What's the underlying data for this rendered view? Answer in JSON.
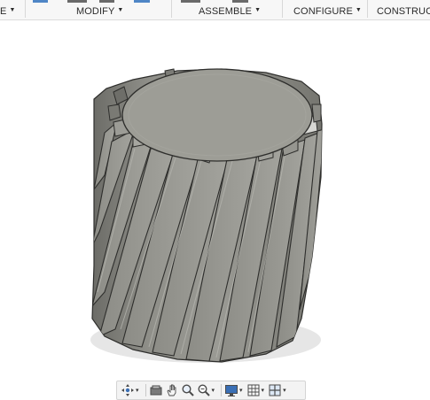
{
  "toolbar": {
    "groups": [
      {
        "label": "E"
      },
      {
        "label": "MODIFY"
      },
      {
        "label": "ASSEMBLE"
      },
      {
        "label": "CONFIGURE"
      },
      {
        "label": "CONSTRUCT"
      }
    ],
    "caret": "▼"
  },
  "viewport": {
    "model": "helical-gear",
    "background": "#ffffff",
    "body_color": "#8a8a84",
    "top_face_color": "#9d9d96"
  },
  "navbar": {
    "tools": [
      {
        "icon": "orbit-icon",
        "has_menu": true
      },
      {
        "icon": "look-at-icon",
        "has_menu": false
      },
      {
        "icon": "pan-icon",
        "has_menu": false
      },
      {
        "icon": "zoom-icon",
        "has_menu": false
      },
      {
        "icon": "fit-zoom-icon",
        "has_menu": true
      },
      {
        "icon": "display-settings-icon",
        "has_menu": true
      },
      {
        "icon": "grid-settings-icon",
        "has_menu": true
      },
      {
        "icon": "viewports-icon",
        "has_menu": true
      }
    ],
    "caret": "▾"
  }
}
